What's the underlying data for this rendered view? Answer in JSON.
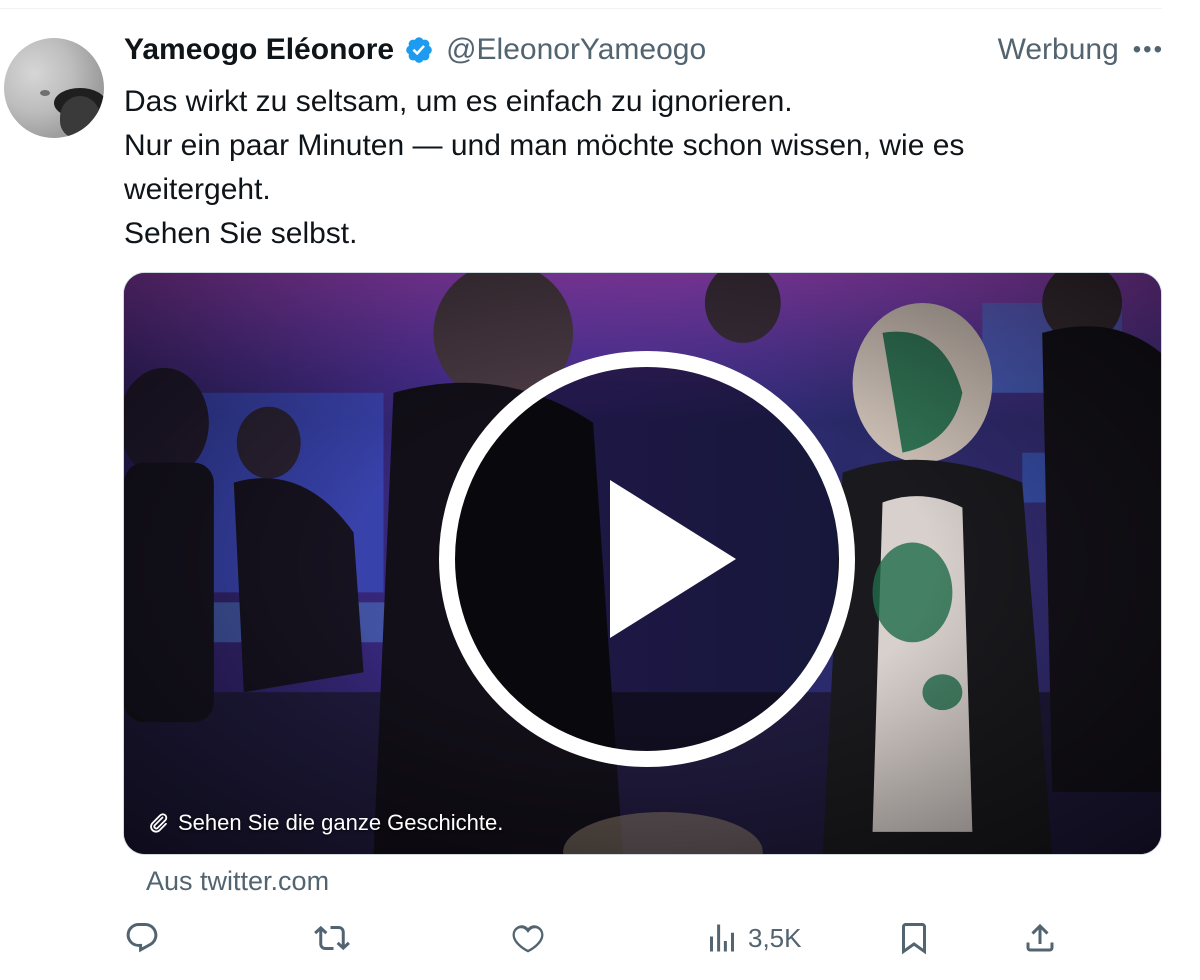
{
  "tweet": {
    "author": {
      "display_name": "Yameogo Eléonore",
      "handle": "@EleonorYameogo",
      "verified": true
    },
    "ad_label": "Werbung",
    "text_lines": [
      "Das wirkt zu seltsam, um es einfach zu ignorieren.",
      "Nur ein paar Minuten — und man möchte schon wissen, wie es",
      "weitergeht.",
      "Sehen Sie selbst."
    ],
    "media": {
      "type": "video",
      "caption": "Sehen Sie die ganze Geschichte.",
      "caption_icon": "paperclip-icon",
      "play_icon": "play-icon"
    },
    "source": "Aus twitter.com",
    "actions": {
      "reply": {
        "icon": "reply-icon"
      },
      "retweet": {
        "icon": "retweet-icon"
      },
      "like": {
        "icon": "heart-icon"
      },
      "views": {
        "icon": "views-icon",
        "count": "3,5K"
      },
      "bookmark": {
        "icon": "bookmark-icon"
      },
      "share": {
        "icon": "share-icon"
      }
    }
  },
  "colors": {
    "text_primary": "#0f1419",
    "text_secondary": "#536471",
    "verified_blue": "#1d9bf0",
    "border": "#cfd9de"
  }
}
